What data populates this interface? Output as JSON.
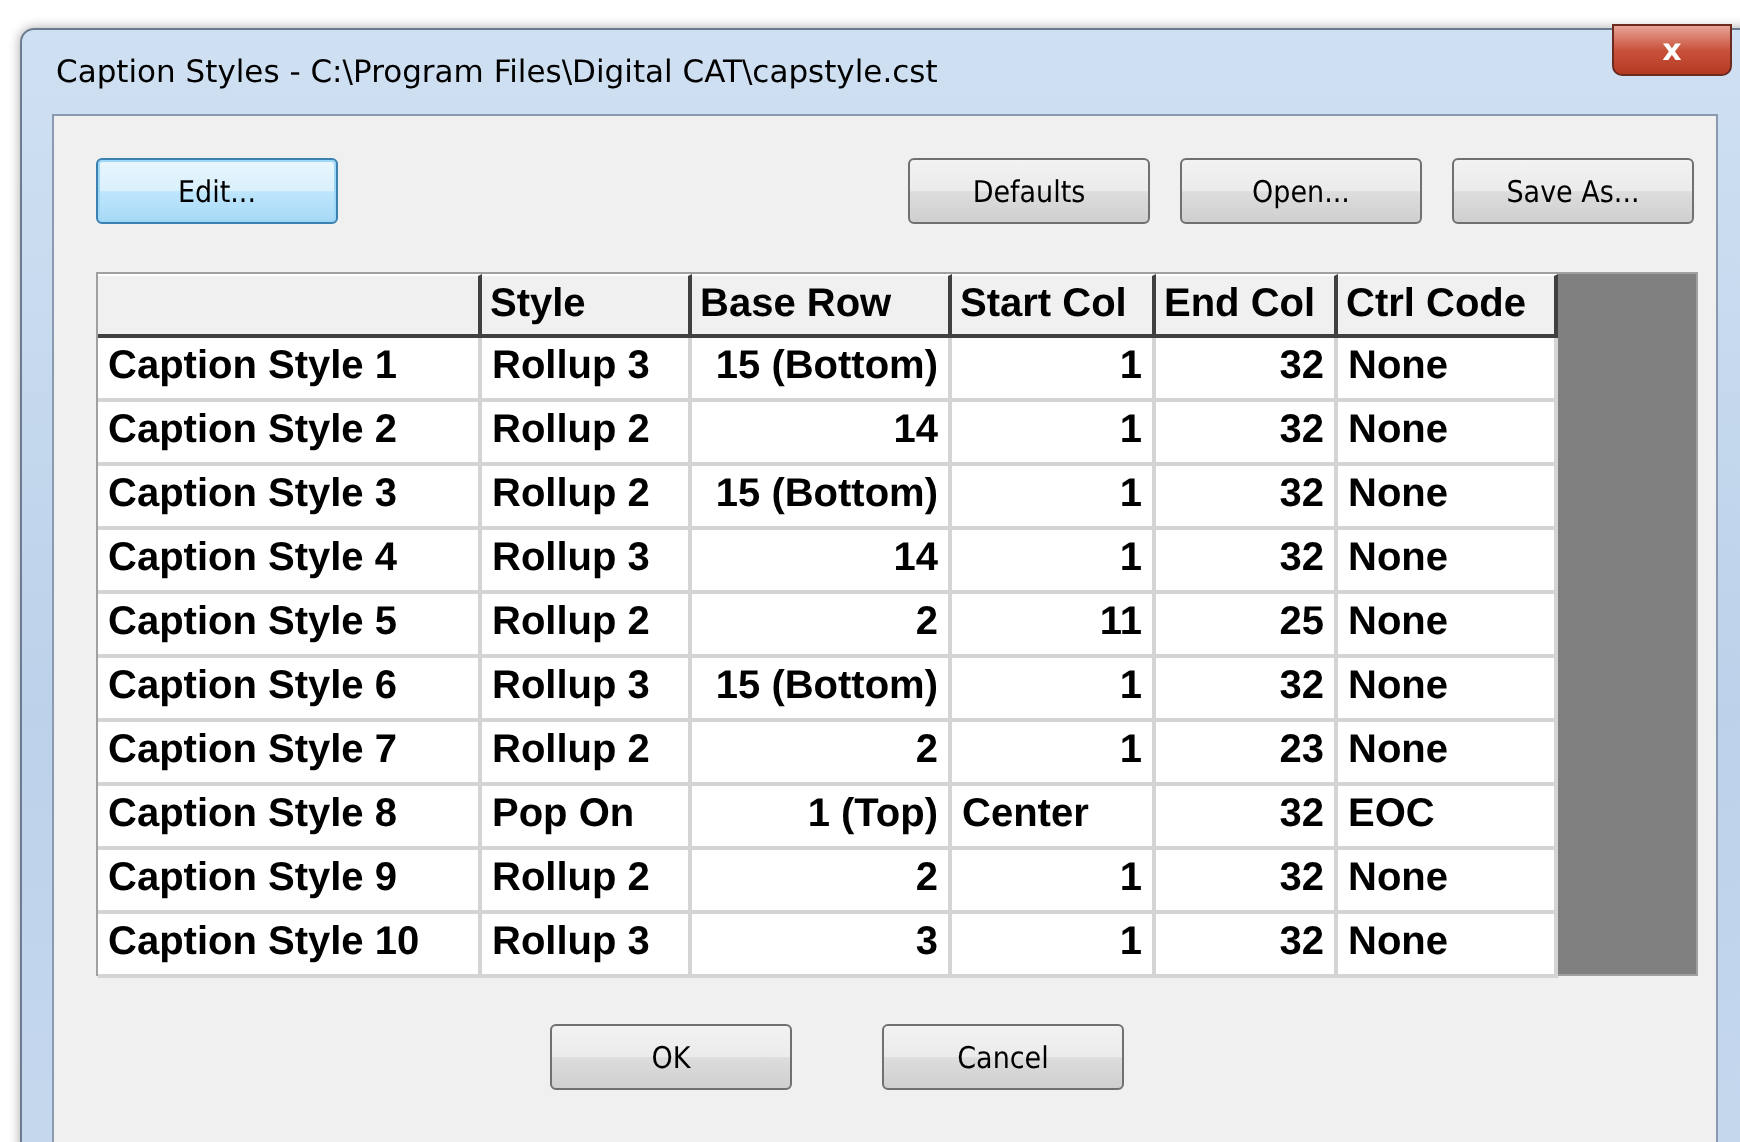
{
  "window": {
    "title": "Caption Styles - C:\\Program Files\\Digital CAT\\capstyle.cst",
    "close": "x"
  },
  "toolbar": {
    "left": [
      {
        "label": "Edit...",
        "focused": true
      }
    ],
    "right": [
      {
        "label": "Defaults",
        "focused": false
      },
      {
        "label": "Open...",
        "focused": false
      },
      {
        "label": "Save As...",
        "focused": false
      }
    ]
  },
  "table": {
    "columns": [
      "",
      "Style",
      "Base Row",
      "Start Col",
      "End Col",
      "Ctrl Code"
    ],
    "rows": [
      [
        {
          "text": "Caption Style 1",
          "kind": "text"
        },
        {
          "text": "Rollup 3",
          "kind": "text"
        },
        {
          "text": "15 (Bottom)",
          "kind": "number"
        },
        {
          "text": "1",
          "kind": "number"
        },
        {
          "text": "32",
          "kind": "number"
        },
        {
          "text": "None",
          "kind": "text"
        }
      ],
      [
        {
          "text": "Caption Style 2",
          "kind": "text"
        },
        {
          "text": "Rollup 2",
          "kind": "text"
        },
        {
          "text": "14",
          "kind": "number"
        },
        {
          "text": "1",
          "kind": "number"
        },
        {
          "text": "32",
          "kind": "number"
        },
        {
          "text": "None",
          "kind": "text"
        }
      ],
      [
        {
          "text": "Caption Style 3",
          "kind": "text"
        },
        {
          "text": "Rollup 2",
          "kind": "text"
        },
        {
          "text": "15 (Bottom)",
          "kind": "number"
        },
        {
          "text": "1",
          "kind": "number"
        },
        {
          "text": "32",
          "kind": "number"
        },
        {
          "text": "None",
          "kind": "text"
        }
      ],
      [
        {
          "text": "Caption Style 4",
          "kind": "text"
        },
        {
          "text": "Rollup 3",
          "kind": "text"
        },
        {
          "text": "14",
          "kind": "number"
        },
        {
          "text": "1",
          "kind": "number"
        },
        {
          "text": "32",
          "kind": "number"
        },
        {
          "text": "None",
          "kind": "text"
        }
      ],
      [
        {
          "text": "Caption Style 5",
          "kind": "text"
        },
        {
          "text": "Rollup 2",
          "kind": "text"
        },
        {
          "text": "2",
          "kind": "number"
        },
        {
          "text": "11",
          "kind": "number"
        },
        {
          "text": "25",
          "kind": "number"
        },
        {
          "text": "None",
          "kind": "text"
        }
      ],
      [
        {
          "text": "Caption Style 6",
          "kind": "text"
        },
        {
          "text": "Rollup 3",
          "kind": "text"
        },
        {
          "text": "15 (Bottom)",
          "kind": "number"
        },
        {
          "text": "1",
          "kind": "number"
        },
        {
          "text": "32",
          "kind": "number"
        },
        {
          "text": "None",
          "kind": "text"
        }
      ],
      [
        {
          "text": "Caption Style 7",
          "kind": "text"
        },
        {
          "text": "Rollup 2",
          "kind": "text"
        },
        {
          "text": "2",
          "kind": "number"
        },
        {
          "text": "1",
          "kind": "number"
        },
        {
          "text": "23",
          "kind": "number"
        },
        {
          "text": "None",
          "kind": "text"
        }
      ],
      [
        {
          "text": "Caption Style 8",
          "kind": "text"
        },
        {
          "text": "Pop On",
          "kind": "text"
        },
        {
          "text": "1 (Top)",
          "kind": "number"
        },
        {
          "text": "Center",
          "kind": "text"
        },
        {
          "text": "32",
          "kind": "number"
        },
        {
          "text": "EOC",
          "kind": "text"
        }
      ],
      [
        {
          "text": "Caption Style 9",
          "kind": "text"
        },
        {
          "text": "Rollup 2",
          "kind": "text"
        },
        {
          "text": "2",
          "kind": "number"
        },
        {
          "text": "1",
          "kind": "number"
        },
        {
          "text": "32",
          "kind": "number"
        },
        {
          "text": "None",
          "kind": "text"
        }
      ],
      [
        {
          "text": "Caption Style 10",
          "kind": "text"
        },
        {
          "text": "Rollup 3",
          "kind": "text"
        },
        {
          "text": "3",
          "kind": "number"
        },
        {
          "text": "1",
          "kind": "number"
        },
        {
          "text": "32",
          "kind": "number"
        },
        {
          "text": "None",
          "kind": "text"
        }
      ]
    ]
  },
  "buttons": [
    "OK",
    "Cancel"
  ]
}
